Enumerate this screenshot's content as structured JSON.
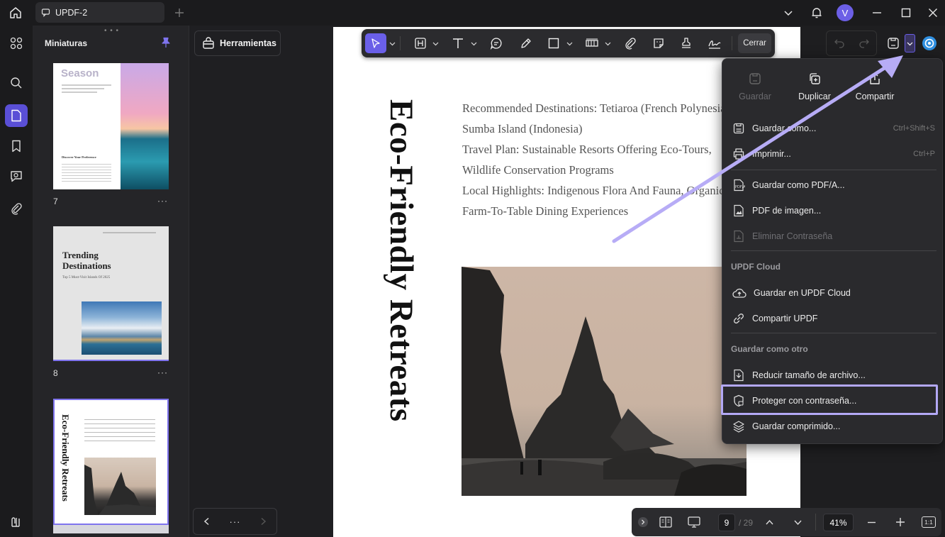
{
  "titlebar": {
    "tab_title": "UPDF-2",
    "avatar_letter": "V"
  },
  "thumbnails": {
    "title": "Miniaturas",
    "pages": [
      {
        "number": "7",
        "heading": "Season",
        "sub_heading": "Discover Your Preference"
      },
      {
        "number": "8",
        "heading": "Trending Destinations",
        "sub_heading": "Top 5 Must-Visit Islands Of 2025"
      },
      {
        "number": "9",
        "heading": "Eco-Friendly Retreats"
      }
    ],
    "more_label": "···"
  },
  "tools_panel": {
    "label": "Herramientas"
  },
  "toolbar": {
    "close_label": "Cerrar",
    "icons": [
      "select-icon",
      "text-box-icon",
      "text-icon",
      "comment-icon",
      "pen-icon",
      "rectangle-icon",
      "stamp-bar-icon",
      "attachment-icon",
      "sticker-icon",
      "stamp-icon",
      "signature-icon"
    ]
  },
  "document": {
    "vertical_title": "Eco-Friendly Retreats",
    "lines": [
      "Recommended Destinations: Tetiaroa (French Polynesia),",
      "Sumba Island (Indonesia)",
      "Travel Plan: Sustainable Resorts Offering Eco-Tours,",
      "Wildlife Conservation Programs",
      "Local Highlights: Indigenous Flora And Fauna, Organic",
      "Farm-To-Table Dining Experiences"
    ]
  },
  "menu": {
    "top_actions": [
      {
        "label": "Guardar",
        "disabled": true
      },
      {
        "label": "Duplicar",
        "disabled": false
      },
      {
        "label": "Compartir",
        "disabled": false
      }
    ],
    "items": [
      {
        "label": "Guardar como...",
        "shortcut": "Ctrl+Shift+S"
      },
      {
        "label": "Imprimir...",
        "shortcut": "Ctrl+P"
      },
      {
        "label": "Guardar como PDF/A..."
      },
      {
        "label": "PDF de imagen..."
      },
      {
        "label": "Eliminar Contraseña",
        "disabled": true
      }
    ],
    "cloud_section": "UPDF Cloud",
    "cloud_items": [
      {
        "label": "Guardar en UPDF Cloud"
      },
      {
        "label": "Compartir UPDF"
      }
    ],
    "other_section": "Guardar como otro",
    "other_items": [
      {
        "label": "Reducir tamaño de archivo..."
      },
      {
        "label": "Proteger con contraseña..."
      },
      {
        "label": "Guardar comprimido..."
      }
    ]
  },
  "bottombar": {
    "current_page": "9",
    "total_pages": "/ 29",
    "zoom": "41%",
    "fit_label": "1:1"
  },
  "colors": {
    "accent": "#6a5fe8",
    "highlight": "#b3a8f5"
  }
}
